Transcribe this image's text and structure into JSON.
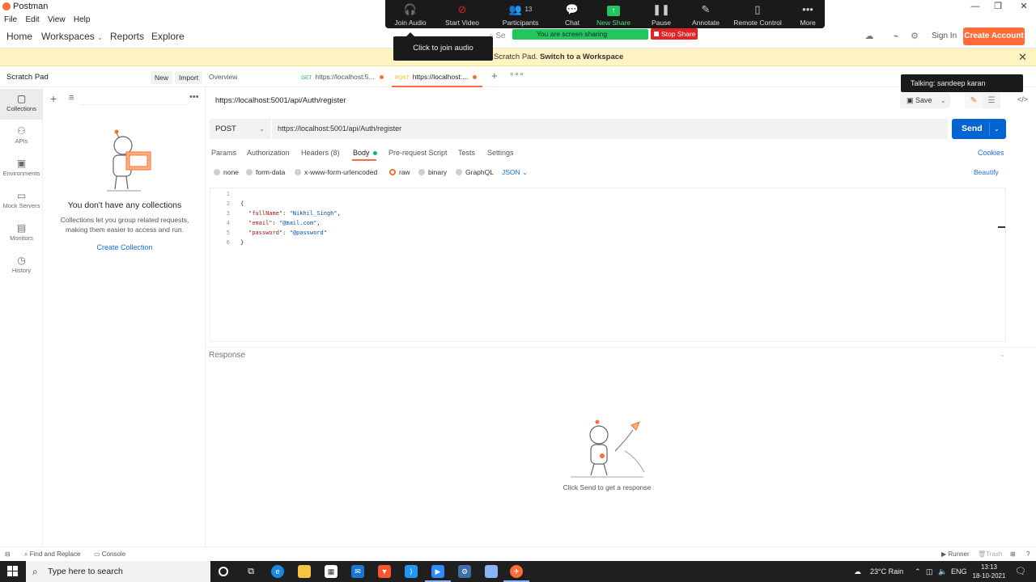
{
  "window": {
    "title": "Postman",
    "controls": [
      "—",
      "❐",
      "✕"
    ]
  },
  "menu": [
    "File",
    "Edit",
    "View",
    "Help"
  ],
  "nav": {
    "home": "Home",
    "workspaces": "Workspaces",
    "reports": "Reports",
    "explore": "Explore",
    "search_partial": "Se",
    "sign_in": "Sign In",
    "create_account": "Create Account"
  },
  "zoom": {
    "items": [
      {
        "label": "Join Audio",
        "icon": "headphones-icon"
      },
      {
        "label": "Start Video",
        "icon": "video-off-icon"
      },
      {
        "label": "Participants",
        "icon": "participants-icon",
        "count": "13"
      },
      {
        "label": "Chat",
        "icon": "chat-icon"
      },
      {
        "label": "New Share",
        "icon": "share-icon"
      },
      {
        "label": "Pause Share",
        "icon": "pause-icon"
      },
      {
        "label": "Annotate",
        "icon": "pen-icon"
      },
      {
        "label": "Remote Control",
        "icon": "mouse-icon"
      },
      {
        "label": "More",
        "icon": "more-icon"
      }
    ],
    "sharing": "You are screen sharing",
    "stop_share": "Stop Share",
    "audio_tooltip": "Click to join audio",
    "talking": "Talking: sandeep karan"
  },
  "banner": {
    "prefix": "Scratch Pad.",
    "link": "Switch to a Workspace"
  },
  "sidebar": {
    "title": "Scratch Pad",
    "new": "New",
    "import": "Import",
    "rail": [
      "Collections",
      "APIs",
      "Environments",
      "Mock Servers",
      "Monitors",
      "History"
    ],
    "empty_title": "You don't have any collections",
    "empty_desc": "Collections let you group related requests, making them easier to access and run.",
    "create_collection": "Create Collection"
  },
  "tabs": [
    {
      "label": "Overview"
    },
    {
      "method": "GET",
      "label": "https://localhost:5..."
    },
    {
      "method": "POST",
      "label": "https://localhost:..."
    }
  ],
  "request": {
    "title": "https://localhost:5001/api/Auth/register",
    "save": "Save",
    "method": "POST",
    "url": "https://localhost:5001/api/Auth/register",
    "send": "Send",
    "subtabs": [
      "Params",
      "Authorization",
      "Headers (8)",
      "Body",
      "Pre-request Script",
      "Tests",
      "Settings"
    ],
    "cookies": "Cookies",
    "body_types": [
      "none",
      "form-data",
      "x-www-form-urlencoded",
      "raw",
      "binary",
      "GraphQL"
    ],
    "selected_body_type": "raw",
    "format": "JSON",
    "beautify": "Beautify",
    "code": {
      "line_numbers": [
        "1",
        "2",
        "3",
        "4",
        "5",
        "6"
      ],
      "open": "{",
      "close": "}",
      "fields": [
        {
          "key": "\"fullName\"",
          "value": "\"Nikhil_Singh\"",
          "sep": ","
        },
        {
          "key": "\"email\"",
          "value": "\"@mail.com\"",
          "sep": ","
        },
        {
          "key": "\"password\"",
          "value": "\"@password\"",
          "sep": ""
        }
      ]
    }
  },
  "response": {
    "label": "Response",
    "hint": "Click Send to get a response"
  },
  "statusbar": {
    "find_replace": "Find and Replace",
    "console": "Console",
    "runner": "Runner",
    "trash": "Trash"
  },
  "taskbar": {
    "search_placeholder": "Type here to search",
    "weather": "23°C  Rain",
    "lang": "ENG",
    "time": "13:13",
    "date": "18-10-2021"
  },
  "colors": {
    "accent": "#ff6c37",
    "send": "#0265d2",
    "link": "#1c6fe0",
    "zoom_green": "#22c55e",
    "zoom_red": "#e02424"
  }
}
